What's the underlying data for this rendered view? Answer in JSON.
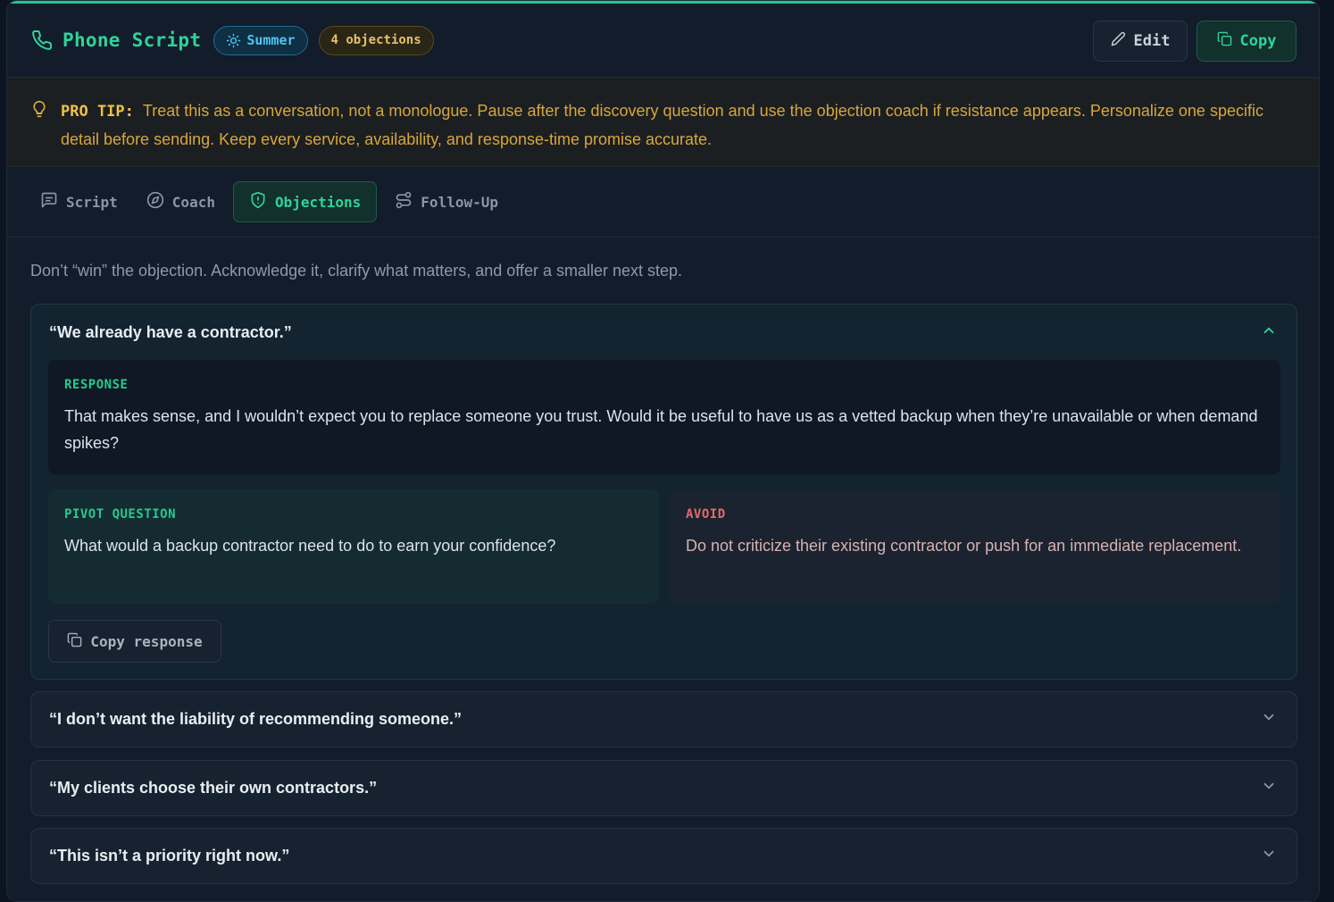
{
  "header": {
    "title": "Phone Script",
    "season_badge": "Summer",
    "objections_badge": "4 objections",
    "edit_label": "Edit",
    "copy_label": "Copy"
  },
  "tip": {
    "label": "PRO TIP:",
    "text": "Treat this as a conversation, not a monologue. Pause after the discovery question and use the objection coach if resistance appears. Personalize one specific detail before sending. Keep every service, availability, and response-time promise accurate."
  },
  "tabs": [
    {
      "label": "Script",
      "icon": "message-square-icon"
    },
    {
      "label": "Coach",
      "icon": "compass-icon"
    },
    {
      "label": "Objections",
      "icon": "shield-icon",
      "active": true
    },
    {
      "label": "Follow-Up",
      "icon": "route-icon"
    }
  ],
  "intro": "Don’t “win” the objection. Acknowledge it, clarify what matters, and offer a smaller next step.",
  "objections": [
    {
      "question": "“We already have a contractor.”",
      "expanded": true,
      "response_label": "RESPONSE",
      "response": "That makes sense, and I wouldn’t expect you to replace someone you trust. Would it be useful to have us as a vetted backup when they’re unavailable or when demand spikes?",
      "pivot_label": "PIVOT QUESTION",
      "pivot": "What would a backup contractor need to do to earn your confidence?",
      "avoid_label": "AVOID",
      "avoid": "Do not criticize their existing contractor or push for an immediate replacement.",
      "copy_label": "Copy response"
    },
    {
      "question": "“I don’t want the liability of recommending someone.”",
      "expanded": false
    },
    {
      "question": "“My clients choose their own contractors.”",
      "expanded": false
    },
    {
      "question": "“This isn’t a priority right now.”",
      "expanded": false
    }
  ],
  "colors": {
    "accent": "#2fd39a",
    "tip": "#d9a63a",
    "season": "#4fc3f0",
    "avoid": "#e46a6a"
  }
}
